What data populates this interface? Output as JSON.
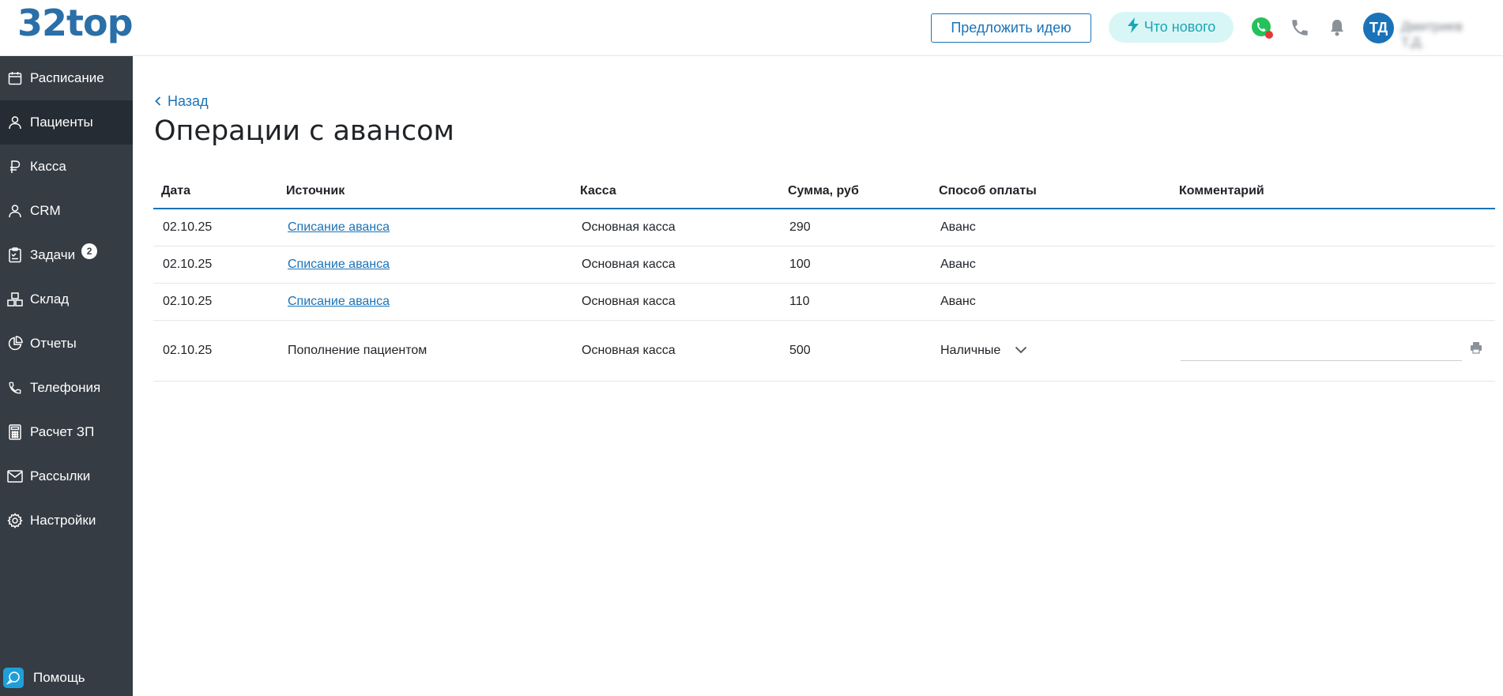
{
  "app": {
    "logo": "32top",
    "suggest_idea": "Предложить идею",
    "whats_new": "Что нового",
    "avatar_initials": "ТД",
    "user_name": "Дмитриев Т.Д."
  },
  "sidebar": {
    "items": [
      {
        "label": "Расписание",
        "icon": "calendar-icon"
      },
      {
        "label": "Пациенты",
        "icon": "user-icon"
      },
      {
        "label": "Касса",
        "icon": "ruble-icon"
      },
      {
        "label": "CRM",
        "icon": "user-icon"
      },
      {
        "label": "Задачи",
        "icon": "tasks-icon",
        "badge": "2"
      },
      {
        "label": "Склад",
        "icon": "boxes-icon"
      },
      {
        "label": "Отчеты",
        "icon": "pie-chart-icon"
      },
      {
        "label": "Телефония",
        "icon": "phone-icon"
      },
      {
        "label": "Расчет ЗП",
        "icon": "calculator-icon"
      },
      {
        "label": "Рассылки",
        "icon": "mail-icon"
      },
      {
        "label": "Настройки",
        "icon": "gear-icon"
      }
    ],
    "help": "Помощь"
  },
  "page": {
    "back": "Назад",
    "title": "Операции с авансом"
  },
  "table": {
    "headers": [
      "Дата",
      "Источник",
      "Касса",
      "Сумма, руб",
      "Способ оплаты",
      "Комментарий"
    ],
    "rows": [
      {
        "date": "02.10.25",
        "source": "Списание аванса",
        "cash": "Основная касса",
        "sum": "290",
        "method": "Аванс"
      },
      {
        "date": "02.10.25",
        "source": "Списание аванса",
        "cash": "Основная касса",
        "sum": "100",
        "method": "Аванс"
      },
      {
        "date": "02.10.25",
        "source": "Списание аванса",
        "cash": "Основная касса",
        "sum": "110",
        "method": "Аванс"
      },
      {
        "date": "02.10.25",
        "source": "Пополнение пациентом",
        "cash": "Основная касса",
        "sum": "500",
        "method": "Наличные"
      }
    ]
  },
  "colors": {
    "accent": "#1a73b8",
    "sidebar": "#353c44",
    "sidebar_active": "#262c33"
  }
}
